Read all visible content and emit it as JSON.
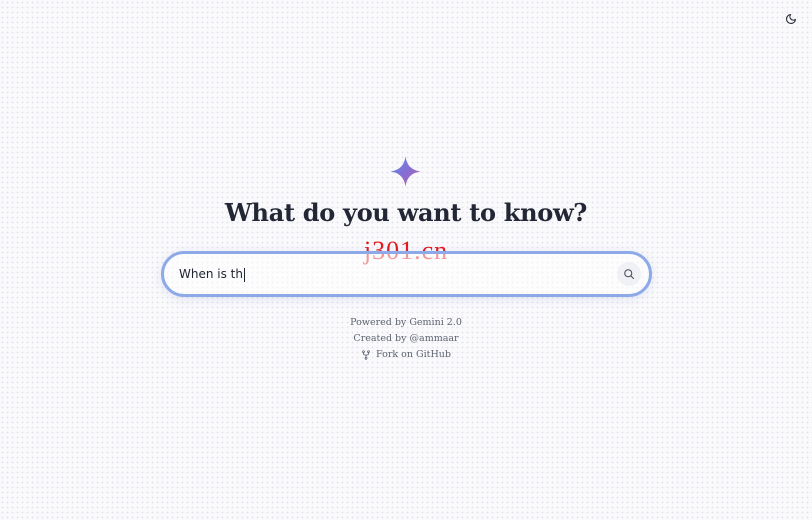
{
  "header": {
    "theme_toggle_icon": "moon-icon"
  },
  "hero": {
    "logo_icon": "sparkle-icon",
    "headline": "What do you want to know?"
  },
  "watermark": "j301.cn",
  "search": {
    "value": "When is th",
    "button_icon": "search-icon"
  },
  "footer": {
    "powered_by": "Powered by Gemini 2.0",
    "created_by": "Created by @ammaar",
    "fork_label": "Fork on GitHub",
    "fork_icon": "git-fork-icon"
  },
  "colors": {
    "accent_border": "#8ea9e8",
    "logo_gradient_start": "#5b8def",
    "logo_gradient_end": "#c2669a"
  }
}
